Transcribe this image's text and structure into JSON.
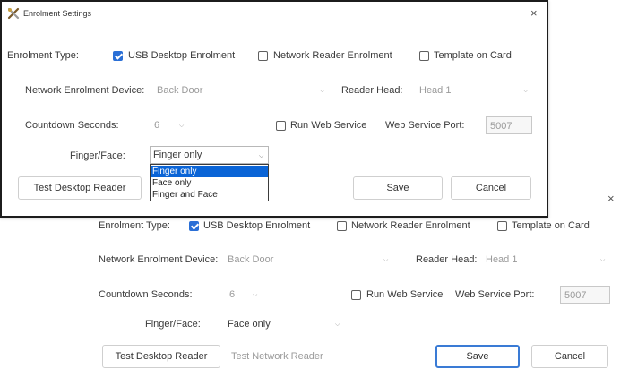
{
  "back_dialog": {
    "close_glyph": "×",
    "enrolment_type_label": "Enrolment Type:",
    "usb_option": {
      "label": "USB Desktop Enrolment",
      "checked": true
    },
    "network_option": {
      "label": "Network Reader Enrolment",
      "checked": false
    },
    "template_option": {
      "label": "Template on Card",
      "checked": false
    },
    "network_device_label": "Network Enrolment Device:",
    "network_device_value": "Back Door",
    "reader_head_label": "Reader Head:",
    "reader_head_value": "Head 1",
    "countdown_label": "Countdown Seconds:",
    "countdown_value": "6",
    "run_web_service": {
      "label": "Run Web Service",
      "checked": false
    },
    "web_service_port_label": "Web Service Port:",
    "web_service_port_value": "5007",
    "finger_face_label": "Finger/Face:",
    "finger_face_value": "Face only",
    "test_desktop_reader": "Test Desktop Reader",
    "test_network_reader": "Test Network Reader",
    "save": "Save",
    "cancel": "Cancel"
  },
  "front_dialog": {
    "title": "Enrolment Settings",
    "title_icon": "tools-icon",
    "close_glyph": "×",
    "enrolment_type_label": "Enrolment Type:",
    "usb_option": {
      "label": "USB Desktop Enrolment",
      "checked": true
    },
    "network_option": {
      "label": "Network Reader Enrolment",
      "checked": false
    },
    "template_option": {
      "label": "Template on Card",
      "checked": false
    },
    "network_device_label": "Network Enrolment Device:",
    "network_device_value": "Back Door",
    "reader_head_label": "Reader Head:",
    "reader_head_value": "Head 1",
    "countdown_label": "Countdown Seconds:",
    "countdown_value": "6",
    "run_web_service": {
      "label": "Run Web Service",
      "checked": false
    },
    "web_service_port_label": "Web Service Port:",
    "web_service_port_value": "5007",
    "finger_face_label": "Finger/Face:",
    "finger_face_value": "Finger only",
    "finger_face_options": [
      "Finger only",
      "Face only",
      "Finger and Face"
    ],
    "finger_face_selected_index": 0,
    "test_desktop_reader": "Test Desktop Reader",
    "save": "Save",
    "cancel": "Cancel"
  },
  "colors": {
    "accent": "#2a6fd6",
    "selection": "#0a64d6",
    "primary_button_border": "#3a7bd5"
  }
}
